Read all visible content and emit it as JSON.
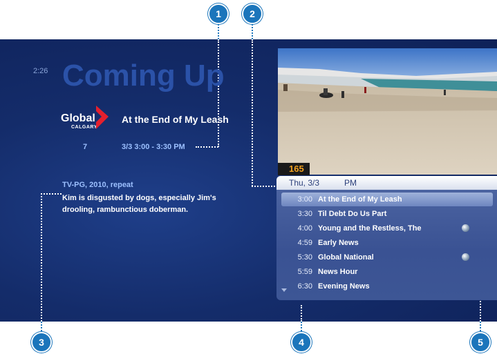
{
  "callouts": [
    "1",
    "2",
    "3",
    "4",
    "5"
  ],
  "preview": {
    "clock": "2:26",
    "heading": "Coming Up",
    "network_logo_text": "Global",
    "network_logo_subtext": "CALGARY",
    "show_title": "At the End of My Leash",
    "channel_number": "7",
    "airing": "3/3  3:00 - 3:30 PM",
    "rating_line": "TV-PG, 2010, repeat",
    "description": "Kim is disgusted by dogs, especially Jim's drooling, rambunctious doberman."
  },
  "video": {
    "channel_badge": "165"
  },
  "guide": {
    "date": "Thu, 3/3",
    "period": "PM",
    "rows": [
      {
        "time": "3:00",
        "title": "At the End of My Leash",
        "selected": true,
        "globe": false
      },
      {
        "time": "3:30",
        "title": "Til Debt Do Us Part",
        "selected": false,
        "globe": false
      },
      {
        "time": "4:00",
        "title": "Young and the Restless, The",
        "selected": false,
        "globe": true
      },
      {
        "time": "4:59",
        "title": "Early News",
        "selected": false,
        "globe": false
      },
      {
        "time": "5:30",
        "title": "Global National",
        "selected": false,
        "globe": true
      },
      {
        "time": "5:59",
        "title": "News Hour",
        "selected": false,
        "globe": false
      },
      {
        "time": "6:30",
        "title": "Evening News",
        "selected": false,
        "globe": false
      }
    ]
  },
  "colors": {
    "background": "#142c6a",
    "callout": "#1b75bb",
    "accent_text": "#9cc0ff",
    "logo_red": "#e4202e",
    "channel_badge_text": "#f0a020"
  }
}
